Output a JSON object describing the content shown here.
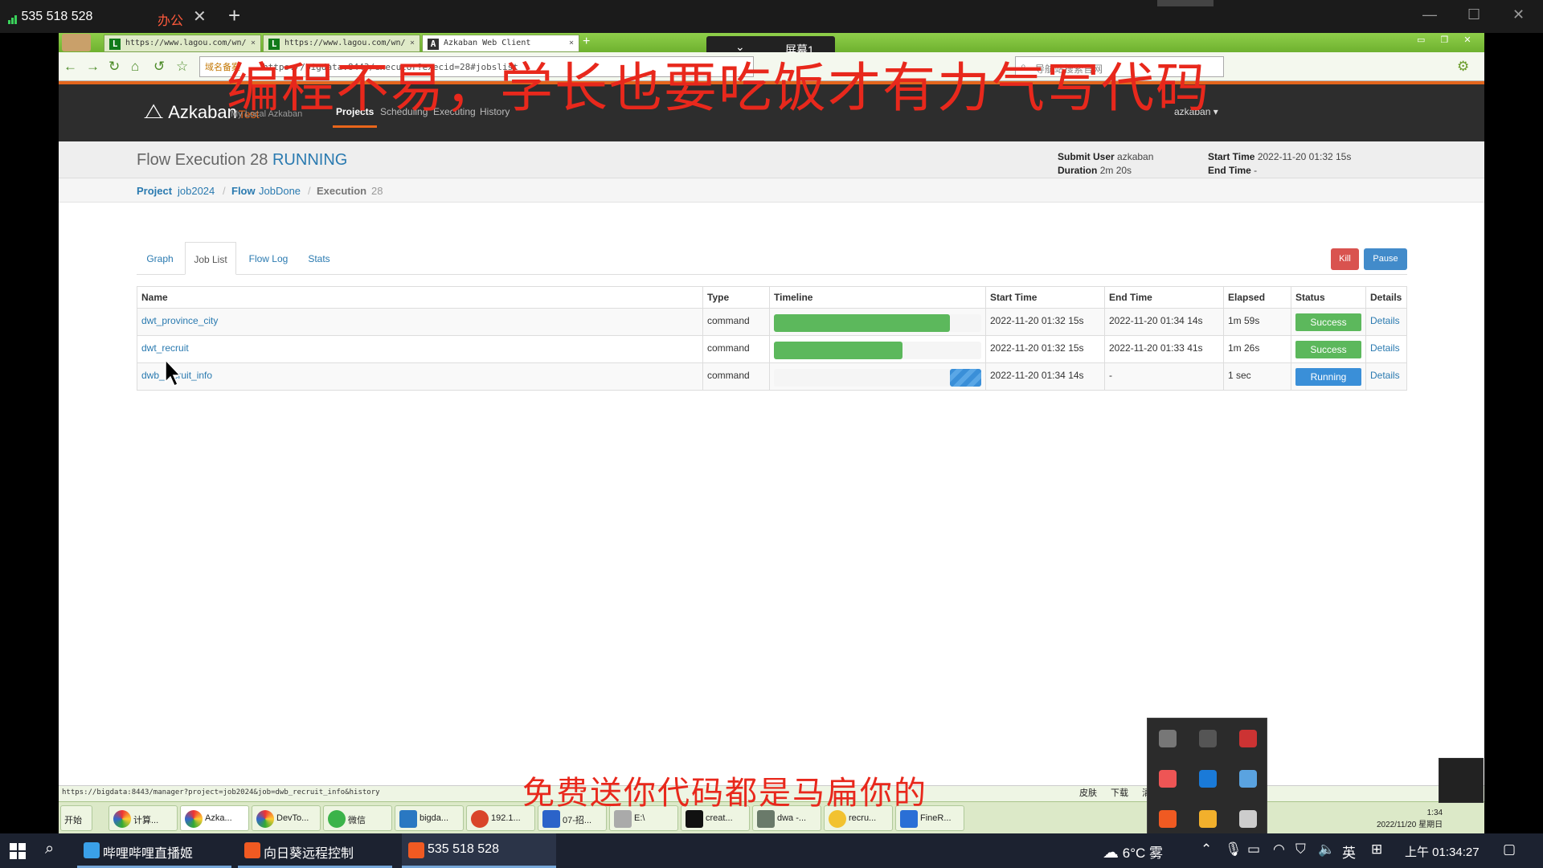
{
  "remote_app": {
    "signal_id": "535 518 528",
    "tab_label": "办公",
    "close_glyph": "✕",
    "add_glyph": "+",
    "screen_label": "屏幕1"
  },
  "browser": {
    "tabs": [
      {
        "label": "https://www.lagou.com/wn/",
        "favicon": "L"
      },
      {
        "label": "https://www.lagou.com/wn/",
        "favicon": "L"
      },
      {
        "label": "Azkaban Web Client",
        "favicon": "A"
      }
    ],
    "address_tag": "域名备案",
    "url": "https://bigdata:8443/executor?execid=28#jobslist",
    "search_placeholder": "导航站搜索官网",
    "status_url": "https://bigdata:8443/manager?project=job2024&job=dwb_recruit_info&history"
  },
  "azkaban": {
    "brand": "Azkaban",
    "env": "Test",
    "subtitle": "My Local Azkaban",
    "nav": [
      "Projects",
      "Scheduling",
      "Executing",
      "History"
    ],
    "active_nav": "Projects",
    "user": "azkaban ▾",
    "flow_title": "Flow Execution 28",
    "flow_status": "RUNNING",
    "submit_user_label": "Submit User",
    "submit_user": "azkaban",
    "duration_label": "Duration",
    "duration": "2m 20s",
    "start_time_label": "Start Time",
    "start_time": "2022-11-20 01:32 15s",
    "end_time_label": "End Time",
    "end_time": "-",
    "breadcrumb": {
      "project_label": "Project",
      "project": "job2024",
      "flow_label": "Flow",
      "flow": "JobDone",
      "execution_label": "Execution",
      "execution": "28"
    },
    "tabs": [
      "Graph",
      "Job List",
      "Flow Log",
      "Stats"
    ],
    "active_tab": "Job List",
    "kill_label": "Kill",
    "pause_label": "Pause",
    "columns": [
      "Name",
      "Type",
      "Timeline",
      "Start Time",
      "End Time",
      "Elapsed",
      "Status",
      "Details"
    ],
    "jobs": [
      {
        "name": "dwt_province_city",
        "type": "command",
        "timeline_start": 0.0,
        "timeline_end": 0.85,
        "start": "2022-11-20 01:32 15s",
        "end": "2022-11-20 01:34 14s",
        "elapsed": "1m 59s",
        "status": "Success",
        "details": "Details"
      },
      {
        "name": "dwt_recruit",
        "type": "command",
        "timeline_start": 0.0,
        "timeline_end": 0.62,
        "start": "2022-11-20 01:32 15s",
        "end": "2022-11-20 01:33 41s",
        "elapsed": "1m 26s",
        "status": "Success",
        "details": "Details"
      },
      {
        "name": "dwb_recruit_info",
        "type": "command",
        "timeline_start": 0.85,
        "timeline_end": 1.0,
        "start": "2022-11-20 01:34 14s",
        "end": "-",
        "elapsed": "1 sec",
        "status": "Running",
        "details": "Details"
      }
    ]
  },
  "overlay": {
    "top_caption": "编程不易，学长也要吃饭才有力气写代码",
    "bottom_caption": "免费送你代码都是马扁你的"
  },
  "xp_taskbar": {
    "start": "开始",
    "items": [
      "计算...",
      "Azka...",
      "DevTo...",
      "微信",
      "bigda...",
      "192.1...",
      "07-招...",
      "E:\\",
      "creat...",
      "dwa -...",
      "recru...",
      "FineR..."
    ],
    "tray_text": "皮肤 下载 清除痕迹",
    "clock_time": "1:34",
    "clock_date": "2022/11/20 星期日"
  },
  "windows_taskbar": {
    "items": [
      "哔哩哔哩直播姬",
      "向日葵远程控制",
      "535 518 528"
    ],
    "weather": "6°C 雾",
    "ime": "英",
    "clock": "上午 01:34:27"
  },
  "colors": {
    "success": "#5cb85c",
    "running": "#3a8fd8",
    "kill": "#d9534f",
    "pause": "#428bca",
    "accent": "#e8651a",
    "caption_red": "#e8281c"
  }
}
